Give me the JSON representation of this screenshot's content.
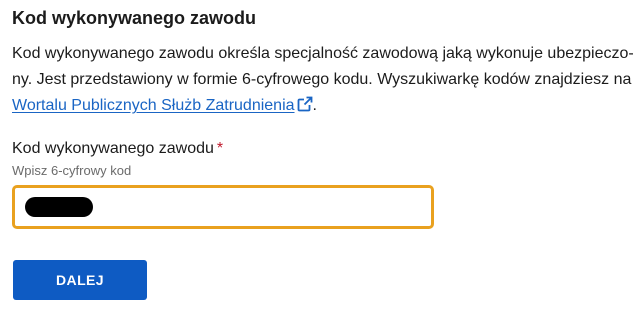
{
  "section": {
    "title": "Kod wykonywanego zawodu",
    "description_text": "Kod wykonywanego zawodu określa specjalność zawodową jaką wykonuje ubezpieczo-ny. Jest przedstawiony w formie 6-cyfrowego kodu. Wyszukiwarkę kodów znajdziesz na ",
    "link_text": "Wortalu Publicznych Służb Zatrudnienia",
    "link_icon": "external-link-icon",
    "description_end": "."
  },
  "field": {
    "label": "Kod wykonywanego zawodu",
    "required_mark": "*",
    "hint": "Wpisz 6-cyfrowy kod",
    "value": "",
    "value_state": "redacted",
    "focus_color": "#e9a11f"
  },
  "actions": {
    "next_label": "DALEJ",
    "button_color": "#0e5bc3"
  },
  "colors": {
    "link": "#1a65c4",
    "required": "#c0182b",
    "text": "#1b1b1b",
    "hint": "#6b6b6b"
  }
}
